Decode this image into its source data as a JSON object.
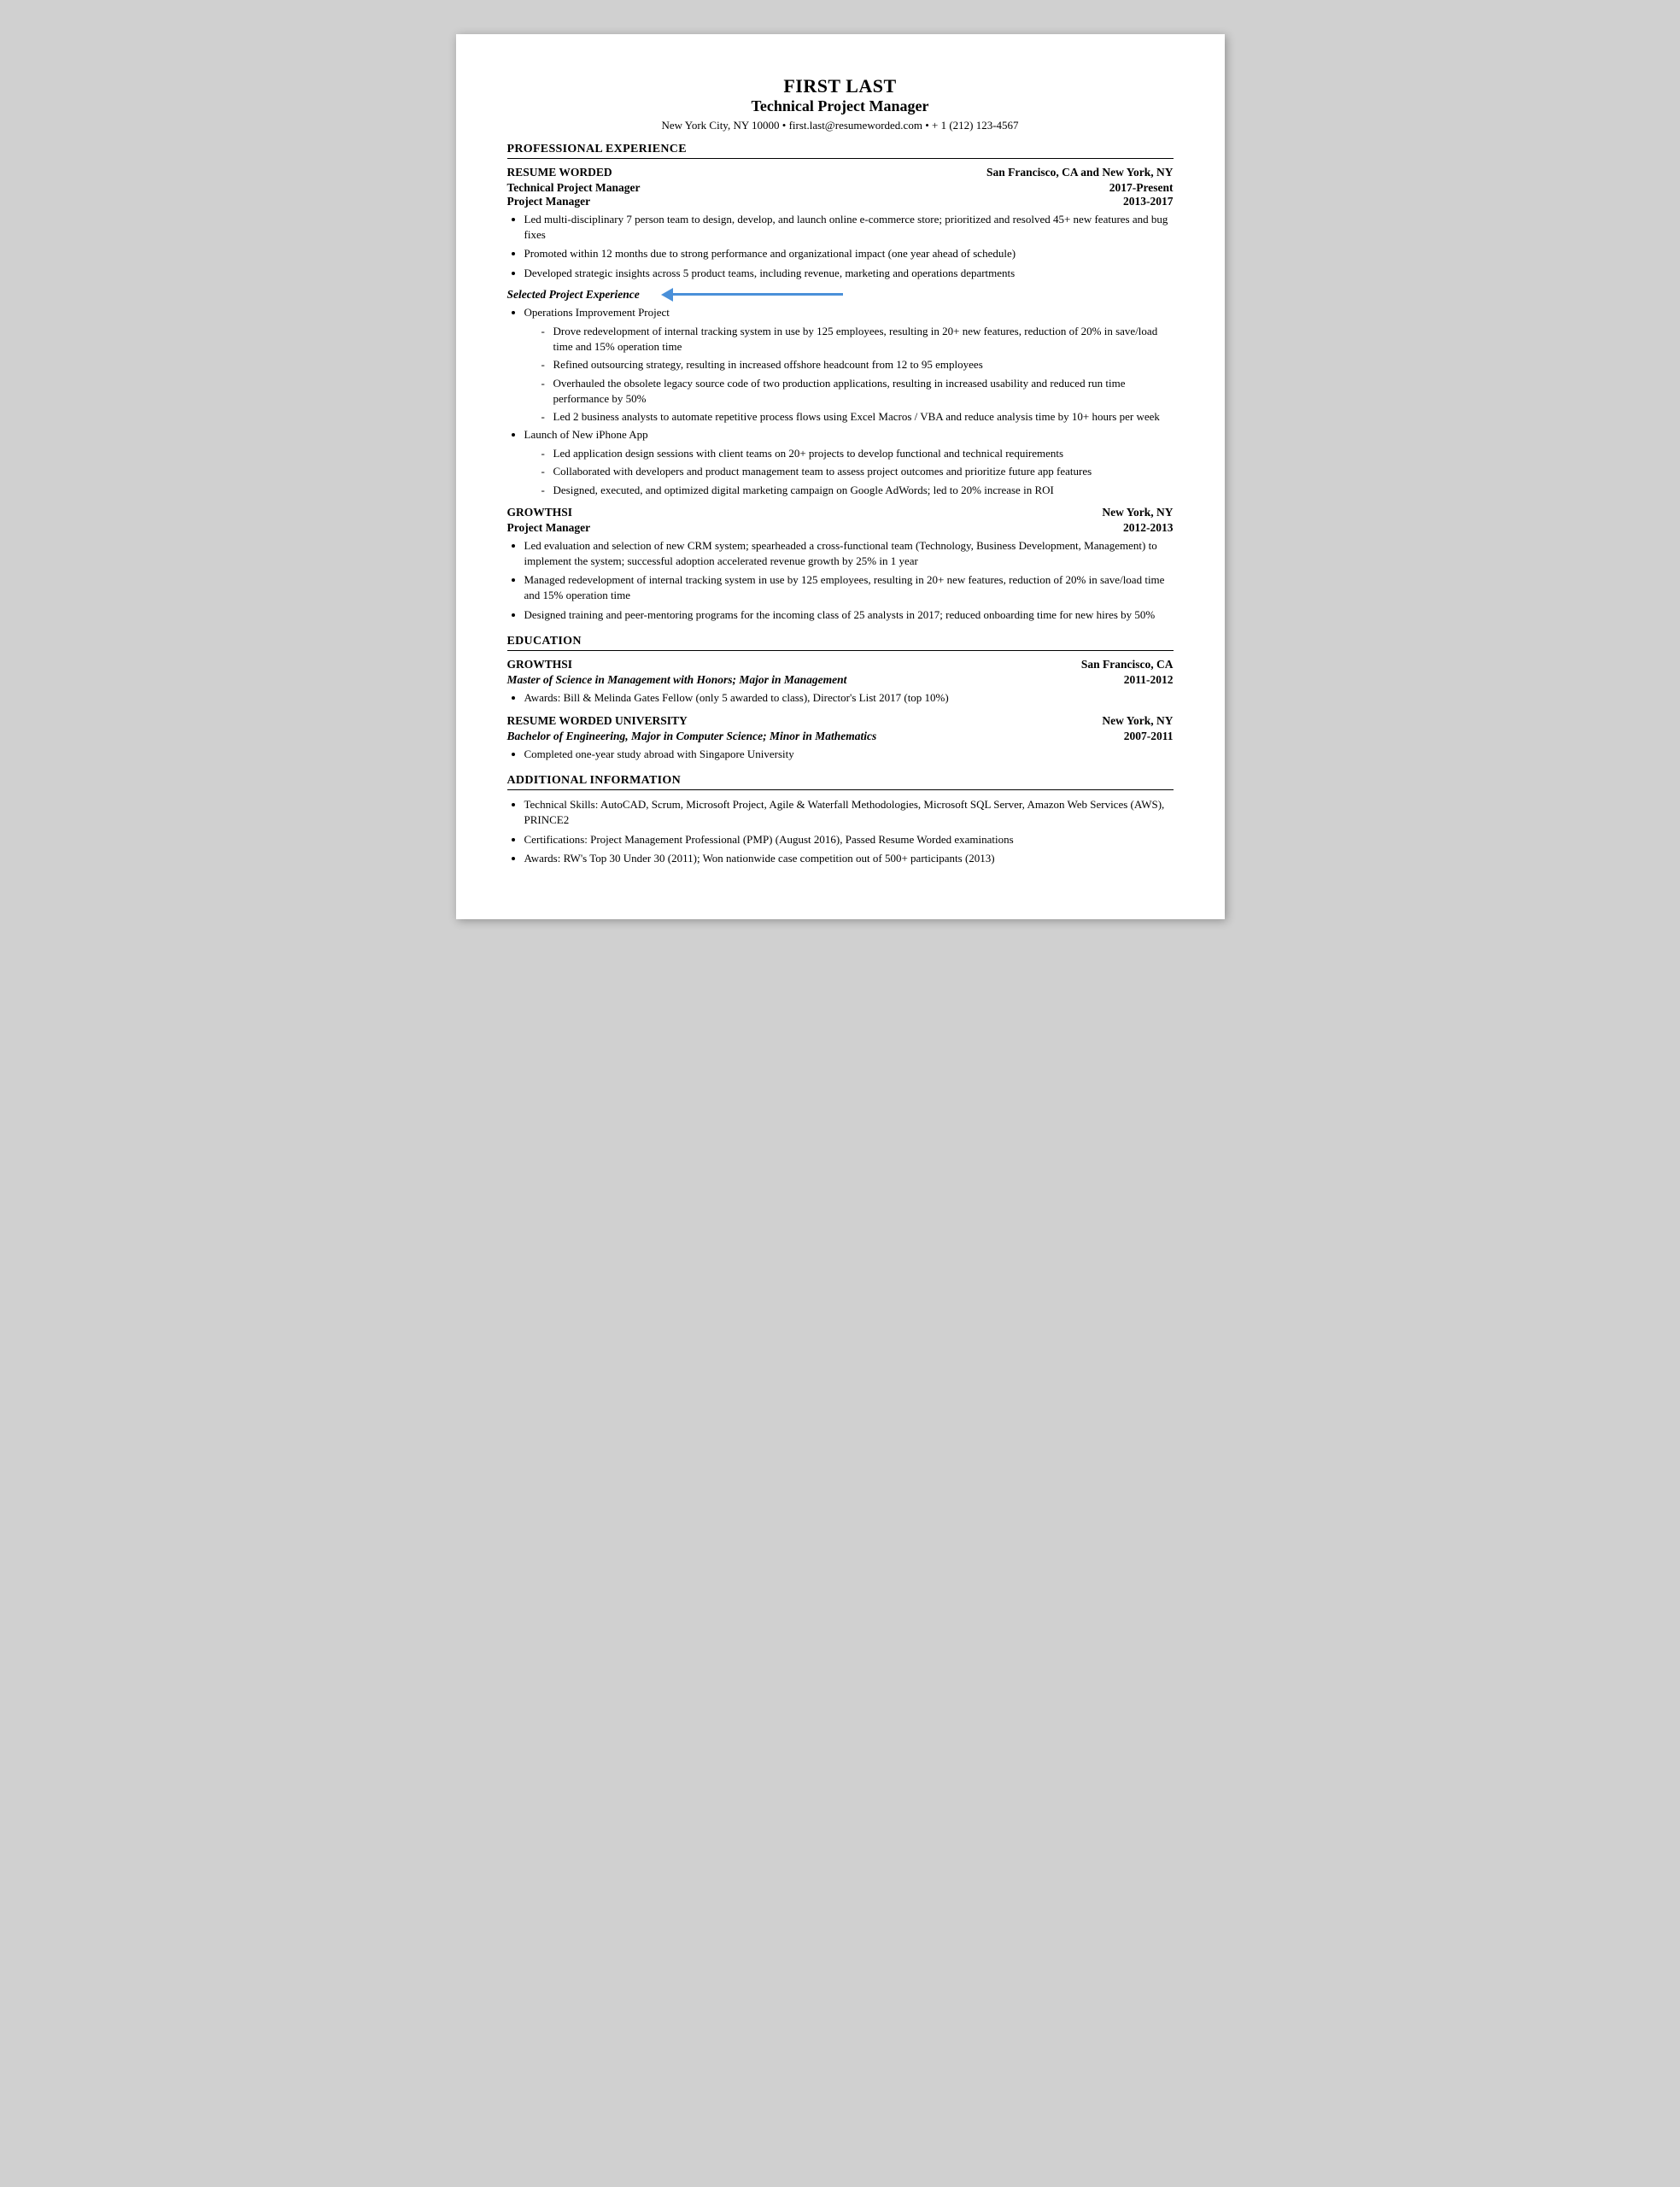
{
  "header": {
    "name": "FIRST LAST",
    "title": "Technical Project Manager",
    "contact": "New York City, NY 10000 • first.last@resumeworded.com • + 1 (212) 123-4567"
  },
  "sections": {
    "professional_experience": {
      "heading": "PROFESSIONAL EXPERIENCE",
      "jobs": [
        {
          "company": "RESUME WORDED",
          "location": "San Francisco, CA and New York, NY",
          "positions": [
            {
              "title": "Technical Project Manager",
              "dates": "2017-Present"
            },
            {
              "title": "Project Manager",
              "dates": "2013-2017"
            }
          ],
          "bullets": [
            "Led multi-disciplinary 7 person team to design, develop, and launch online e-commerce store; prioritized and resolved 45+ new features and bug fixes",
            "Promoted within 12 months due to strong performance and organizational impact (one year ahead of schedule)",
            "Developed strategic insights across 5 product teams, including revenue, marketing and operations departments"
          ],
          "selected_project": {
            "label": "Selected Project Experience",
            "projects": [
              {
                "name": "Operations Improvement Project",
                "sub_bullets": [
                  "Drove redevelopment of internal tracking system in use by 125 employees, resulting in 20+ new features, reduction of 20% in save/load time and 15% operation time",
                  "Refined outsourcing strategy, resulting in increased offshore headcount from 12 to 95 employees",
                  "Overhauled the obsolete legacy source code of two production applications, resulting in increased usability and reduced run time performance by 50%",
                  "Led 2 business analysts to automate repetitive process flows using Excel Macros / VBA and reduce analysis time by 10+ hours per week"
                ]
              },
              {
                "name": "Launch of New iPhone App",
                "sub_bullets": [
                  "Led application design sessions with client teams on 20+ projects to develop functional and technical requirements",
                  "Collaborated with developers and product management team to assess project outcomes and prioritize future app features",
                  "Designed, executed, and optimized digital marketing campaign on Google AdWords; led to 20% increase in ROI"
                ]
              }
            ]
          }
        },
        {
          "company": "GROWTHSI",
          "location": "New York, NY",
          "positions": [
            {
              "title": "Project Manager",
              "dates": "2012-2013"
            }
          ],
          "bullets": [
            "Led evaluation and selection of new CRM system; spearheaded a cross-functional team (Technology, Business Development, Management) to implement the system; successful adoption accelerated revenue growth by 25% in 1 year",
            "Managed redevelopment of internal tracking system in use by 125 employees, resulting in 20+ new features, reduction of 20% in save/load time and 15% operation time",
            "Designed training and peer-mentoring programs for the incoming class of 25 analysts in 2017; reduced onboarding time for new hires by 50%"
          ]
        }
      ]
    },
    "education": {
      "heading": "EDUCATION",
      "schools": [
        {
          "name": "GROWTHSI",
          "location": "San Francisco, CA",
          "degree": "Master of Science in Management with Honors; Major in Management",
          "dates": "2011-2012",
          "bullets": [
            "Awards: Bill & Melinda Gates Fellow (only 5 awarded to class), Director's List 2017 (top 10%)"
          ]
        },
        {
          "name": "RESUME WORDED UNIVERSITY",
          "location": "New York, NY",
          "degree": "Bachelor of Engineering, Major in Computer Science; Minor in Mathematics",
          "dates": "2007-2011",
          "bullets": [
            "Completed one-year study abroad with Singapore University"
          ]
        }
      ]
    },
    "additional_information": {
      "heading": "ADDITIONAL INFORMATION",
      "bullets": [
        "Technical Skills: AutoCAD, Scrum, Microsoft Project, Agile & Waterfall Methodologies, Microsoft SQL Server, Amazon Web Services (AWS), PRINCE2",
        "Certifications: Project Management Professional (PMP) (August 2016), Passed Resume Worded examinations",
        "Awards: RW's Top 30 Under 30 (2011); Won nationwide case competition out of 500+ participants (2013)"
      ]
    }
  },
  "arrow": {
    "color": "#4a90d9"
  }
}
